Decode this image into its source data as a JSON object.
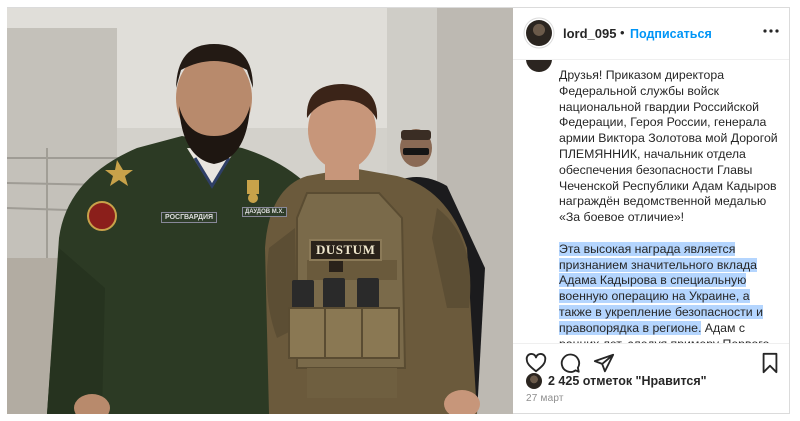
{
  "post": {
    "username": "lord_095",
    "separator": "•",
    "follow_label": "Подписаться",
    "more_icon": "more-icon",
    "caption": {
      "paragraph1": "Друзья! Приказом директора Федеральной службы войск национальной гвардии Российской Федерации, Героя России, генерала армии Виктора Золотова мой Дорогой ПЛЕМЯННИК, начальник отдела обеспечения безопасности Главы Чеченской Республики Адам Кадыров награждён ведомственной медалью «За боевое отличие»!",
      "paragraph2_highlighted": "Эта высокая награда является признанием значительного вклада Адама Кадырова в специальную военную операцию на Украине, а также в укрепление безопасности и правопорядка в регионе.",
      "paragraph2_rest": " Адам с ранних лет, следуя примеру Первого"
    },
    "actions": [
      "heart-icon",
      "comment-icon",
      "share-icon",
      "bookmark-icon"
    ],
    "likes_text": "2 425 отметок \"Нравится\"",
    "date": "27 март"
  },
  "photo": {
    "patch_left": "РОСГВАРДИЯ",
    "patch_right": "ДАУДОВ М.Х.",
    "vest_patch": "DUSTUM"
  },
  "colors": {
    "accent": "#0095f6",
    "text": "#262626",
    "muted": "#8e8e8e",
    "highlight": "#b4d5fe",
    "border": "#dbdbdb"
  }
}
